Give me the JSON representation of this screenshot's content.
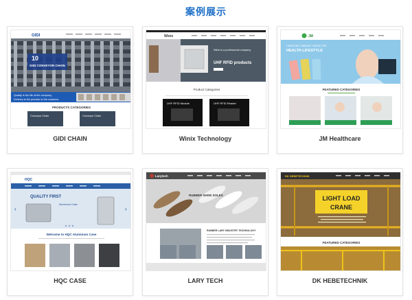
{
  "page": {
    "title": "案例展示"
  },
  "cards": [
    {
      "label": "GIDI CHAIN",
      "logo": "GIDI",
      "banner_title": "GIDI CONVEYOR CHAIN",
      "banner_num": "10",
      "slogan1": "Quality is the life of the company,",
      "slogan2": "Delivery is the promise to the customer",
      "section": "PRODUCTS CATEGORIES",
      "item1": "Conveyor Chain",
      "item2": "Conveyor Chain"
    },
    {
      "label": "Winix Technology",
      "logo": "Winix",
      "banner_title": "UHF RFID products",
      "banner_sub": "Winix is a professional company",
      "section": "Product Categories",
      "item1": "UHF RFID Module",
      "item2": "UHF RFID Reader"
    },
    {
      "label": "JM Healthcare",
      "logo": "JM",
      "banner_title": "HEALTH LIFESTYLE",
      "banner_sub": "CREATING VIBRANT IDEAS FOR",
      "section": "FEATURED CATEGORIES"
    },
    {
      "label": "HQC CASE",
      "logo": "HQC",
      "banner_title": "QUALITY FIRST",
      "banner_sub": "Aluminum Case",
      "welcome": "Welcome to HQC Aluminum Case",
      "prev_icon": "chevron-left-icon",
      "next_icon": "chevron-right-icon"
    },
    {
      "label": "LARY TECH",
      "logo": "Larytech",
      "banner_title": "RUBBER SHOE SOLES",
      "section": "RUBBER LARY INDUSTRY TECHNOLOGY"
    },
    {
      "label": "DK HEBETECHNIK",
      "logo": "DK HEBETECHNIK",
      "banner_title1": "LIGHT LOAD",
      "banner_title2": "CRANE",
      "section": "FEATURED CATEGORIES"
    }
  ]
}
